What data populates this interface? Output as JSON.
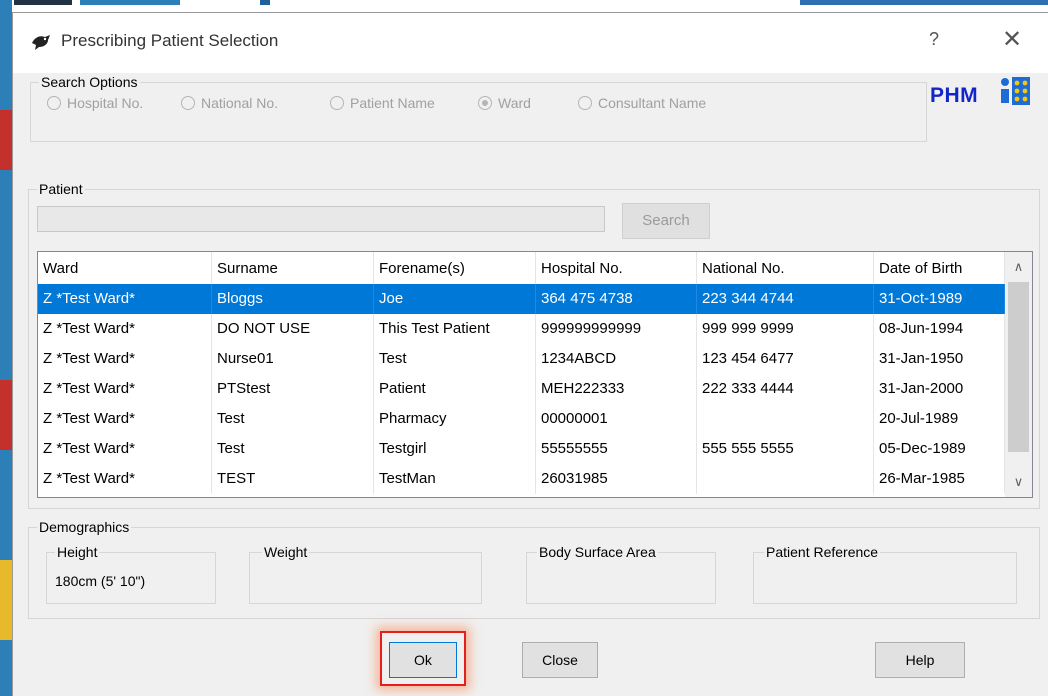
{
  "window": {
    "title": "Prescribing Patient Selection",
    "help_glyph": "?",
    "close_glyph": "✕",
    "icon": "app-bird-icon"
  },
  "search_options": {
    "label": "Search Options",
    "radios": [
      {
        "label": "Hospital No.",
        "selected": false
      },
      {
        "label": "National No.",
        "selected": false
      },
      {
        "label": "Patient Name",
        "selected": false
      },
      {
        "label": "Ward",
        "selected": true
      },
      {
        "label": "Consultant Name",
        "selected": false
      }
    ]
  },
  "brand": {
    "text": "PHM",
    "text_color": "#1226c8",
    "logo_colors": [
      "#1e6bd6",
      "#f2c80f"
    ]
  },
  "patient": {
    "label": "Patient",
    "search_value": "",
    "search_button": "Search"
  },
  "table": {
    "columns": [
      "Ward",
      "Surname",
      "Forename(s)",
      "Hospital No.",
      "National No.",
      "Date of Birth"
    ],
    "rows": [
      [
        "Z *Test Ward*",
        "Bloggs",
        "Joe",
        "364 475 4738",
        "223 344 4744",
        "31-Oct-1989"
      ],
      [
        "Z *Test Ward*",
        "DO NOT USE",
        "This Test Patient",
        "999999999999",
        "999 999 9999",
        "08-Jun-1994"
      ],
      [
        "Z *Test Ward*",
        "Nurse01",
        "Test",
        "1234ABCD",
        "123 454 6477",
        "31-Jan-1950"
      ],
      [
        "Z *Test Ward*",
        "PTStest",
        "Patient",
        "MEH222333",
        "222 333 4444",
        "31-Jan-2000"
      ],
      [
        "Z *Test Ward*",
        "Test",
        "Pharmacy",
        "00000001",
        "",
        "20-Jul-1989"
      ],
      [
        "Z *Test Ward*",
        "Test",
        "Testgirl",
        "55555555",
        "555 555 5555",
        "05-Dec-1989"
      ],
      [
        "Z *Test Ward*",
        "TEST",
        "TestMan",
        "26031985",
        "",
        "26-Mar-1985"
      ]
    ],
    "selected_row": 0,
    "selected_color": "#0078d7",
    "scroll_up_glyph": "∧",
    "scroll_down_glyph": "∨"
  },
  "demographics": {
    "label": "Demographics",
    "height_label": "Height",
    "height_value": "180cm (5' 10\")",
    "weight_label": "Weight",
    "bsa_label": "Body Surface Area",
    "ref_label": "Patient Reference"
  },
  "buttons": {
    "ok": "Ok",
    "close": "Close",
    "help": "Help"
  },
  "highlight_color": "#e22020"
}
